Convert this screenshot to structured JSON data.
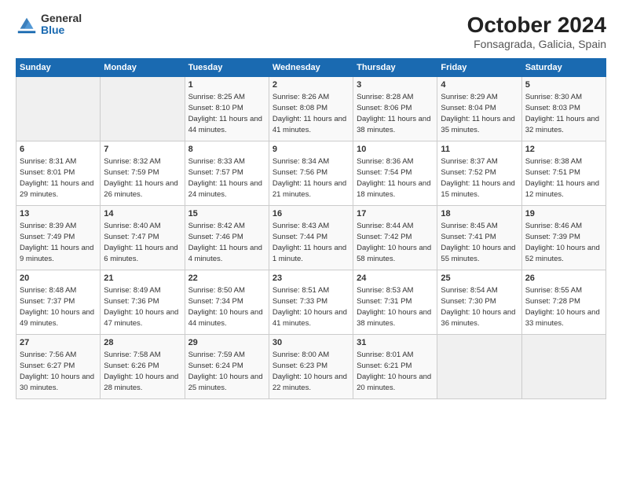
{
  "logo": {
    "general": "General",
    "blue": "Blue"
  },
  "title": "October 2024",
  "location": "Fonsagrada, Galicia, Spain",
  "days_of_week": [
    "Sunday",
    "Monday",
    "Tuesday",
    "Wednesday",
    "Thursday",
    "Friday",
    "Saturday"
  ],
  "weeks": [
    [
      {
        "day": "",
        "info": ""
      },
      {
        "day": "",
        "info": ""
      },
      {
        "day": "1",
        "info": "Sunrise: 8:25 AM\nSunset: 8:10 PM\nDaylight: 11 hours and 44 minutes."
      },
      {
        "day": "2",
        "info": "Sunrise: 8:26 AM\nSunset: 8:08 PM\nDaylight: 11 hours and 41 minutes."
      },
      {
        "day": "3",
        "info": "Sunrise: 8:28 AM\nSunset: 8:06 PM\nDaylight: 11 hours and 38 minutes."
      },
      {
        "day": "4",
        "info": "Sunrise: 8:29 AM\nSunset: 8:04 PM\nDaylight: 11 hours and 35 minutes."
      },
      {
        "day": "5",
        "info": "Sunrise: 8:30 AM\nSunset: 8:03 PM\nDaylight: 11 hours and 32 minutes."
      }
    ],
    [
      {
        "day": "6",
        "info": "Sunrise: 8:31 AM\nSunset: 8:01 PM\nDaylight: 11 hours and 29 minutes."
      },
      {
        "day": "7",
        "info": "Sunrise: 8:32 AM\nSunset: 7:59 PM\nDaylight: 11 hours and 26 minutes."
      },
      {
        "day": "8",
        "info": "Sunrise: 8:33 AM\nSunset: 7:57 PM\nDaylight: 11 hours and 24 minutes."
      },
      {
        "day": "9",
        "info": "Sunrise: 8:34 AM\nSunset: 7:56 PM\nDaylight: 11 hours and 21 minutes."
      },
      {
        "day": "10",
        "info": "Sunrise: 8:36 AM\nSunset: 7:54 PM\nDaylight: 11 hours and 18 minutes."
      },
      {
        "day": "11",
        "info": "Sunrise: 8:37 AM\nSunset: 7:52 PM\nDaylight: 11 hours and 15 minutes."
      },
      {
        "day": "12",
        "info": "Sunrise: 8:38 AM\nSunset: 7:51 PM\nDaylight: 11 hours and 12 minutes."
      }
    ],
    [
      {
        "day": "13",
        "info": "Sunrise: 8:39 AM\nSunset: 7:49 PM\nDaylight: 11 hours and 9 minutes."
      },
      {
        "day": "14",
        "info": "Sunrise: 8:40 AM\nSunset: 7:47 PM\nDaylight: 11 hours and 6 minutes."
      },
      {
        "day": "15",
        "info": "Sunrise: 8:42 AM\nSunset: 7:46 PM\nDaylight: 11 hours and 4 minutes."
      },
      {
        "day": "16",
        "info": "Sunrise: 8:43 AM\nSunset: 7:44 PM\nDaylight: 11 hours and 1 minute."
      },
      {
        "day": "17",
        "info": "Sunrise: 8:44 AM\nSunset: 7:42 PM\nDaylight: 10 hours and 58 minutes."
      },
      {
        "day": "18",
        "info": "Sunrise: 8:45 AM\nSunset: 7:41 PM\nDaylight: 10 hours and 55 minutes."
      },
      {
        "day": "19",
        "info": "Sunrise: 8:46 AM\nSunset: 7:39 PM\nDaylight: 10 hours and 52 minutes."
      }
    ],
    [
      {
        "day": "20",
        "info": "Sunrise: 8:48 AM\nSunset: 7:37 PM\nDaylight: 10 hours and 49 minutes."
      },
      {
        "day": "21",
        "info": "Sunrise: 8:49 AM\nSunset: 7:36 PM\nDaylight: 10 hours and 47 minutes."
      },
      {
        "day": "22",
        "info": "Sunrise: 8:50 AM\nSunset: 7:34 PM\nDaylight: 10 hours and 44 minutes."
      },
      {
        "day": "23",
        "info": "Sunrise: 8:51 AM\nSunset: 7:33 PM\nDaylight: 10 hours and 41 minutes."
      },
      {
        "day": "24",
        "info": "Sunrise: 8:53 AM\nSunset: 7:31 PM\nDaylight: 10 hours and 38 minutes."
      },
      {
        "day": "25",
        "info": "Sunrise: 8:54 AM\nSunset: 7:30 PM\nDaylight: 10 hours and 36 minutes."
      },
      {
        "day": "26",
        "info": "Sunrise: 8:55 AM\nSunset: 7:28 PM\nDaylight: 10 hours and 33 minutes."
      }
    ],
    [
      {
        "day": "27",
        "info": "Sunrise: 7:56 AM\nSunset: 6:27 PM\nDaylight: 10 hours and 30 minutes."
      },
      {
        "day": "28",
        "info": "Sunrise: 7:58 AM\nSunset: 6:26 PM\nDaylight: 10 hours and 28 minutes."
      },
      {
        "day": "29",
        "info": "Sunrise: 7:59 AM\nSunset: 6:24 PM\nDaylight: 10 hours and 25 minutes."
      },
      {
        "day": "30",
        "info": "Sunrise: 8:00 AM\nSunset: 6:23 PM\nDaylight: 10 hours and 22 minutes."
      },
      {
        "day": "31",
        "info": "Sunrise: 8:01 AM\nSunset: 6:21 PM\nDaylight: 10 hours and 20 minutes."
      },
      {
        "day": "",
        "info": ""
      },
      {
        "day": "",
        "info": ""
      }
    ]
  ]
}
